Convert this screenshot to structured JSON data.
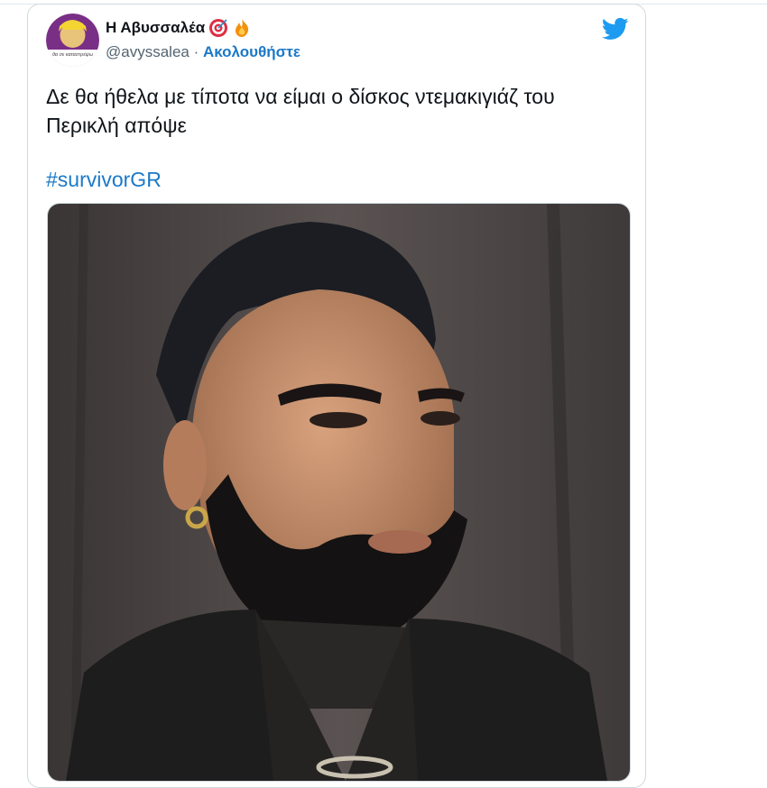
{
  "tweet": {
    "display_name": "Η Αβυσσαλέα",
    "emojis": [
      "target-emoji",
      "fire-emoji"
    ],
    "handle": "@avyssalea",
    "separator": " · ",
    "follow_label": "Ακολουθήστε",
    "text": "Δε θα ήθελα με τίποτα να είμαι ο δίσκος ντεμακιγιάζ του Περικλή απόψε",
    "hashtag": "#survivorGR",
    "avatar_caption": "θα σε καταστρέψω"
  },
  "colors": {
    "accent": "#1d9bf0",
    "link": "#1b79c8",
    "text": "#0f1419",
    "secondary": "#536471"
  }
}
